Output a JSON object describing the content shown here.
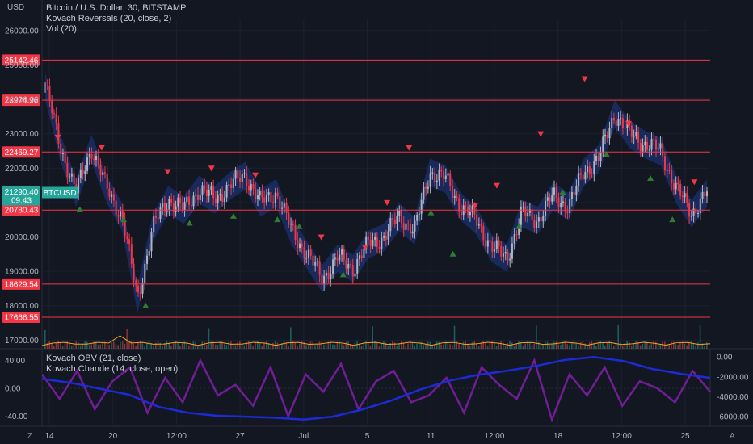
{
  "header": {
    "currency_label": "USD",
    "symbol_line": "Bitcoin / U.S. Dollar, 30, BITSTAMP",
    "indicator_1": "Kovach Reversals (20, close, 2)",
    "indicator_2": "Vol (20)"
  },
  "sub_pane": {
    "indicator_1": "Kovach OBV (21, close)",
    "indicator_2": "Kovach Chande (14, close, open)"
  },
  "price_badge": {
    "price": "21290.40",
    "countdown": "09:43",
    "symbol": "BTCUSD",
    "color": "#26a69a"
  },
  "colors": {
    "background": "#131722",
    "level_line": "#f23645",
    "candle_up": "#b2b5be",
    "reversal_up": "#2e7d32",
    "reversal_down": "#f23645",
    "band": "#1e3a8a",
    "chande": "#7b1fa2",
    "obv": "#1c2bd6",
    "volume": "#f7a21b"
  },
  "footer": {
    "left_icon": "Z",
    "right_icon": "A"
  },
  "chart_data": [
    {
      "type": "line",
      "title": "Bitcoin / U.S. Dollar, 30, BITSTAMP",
      "x_ticks": [
        "14",
        "20",
        "12:00",
        "27",
        "Jul",
        "5",
        "11",
        "12:00",
        "18",
        "12:00",
        "25"
      ],
      "y_ticks": [
        "17000.00",
        "18000.00",
        "19000.00",
        "20000.00",
        "21000.00",
        "22000.00",
        "23000.00",
        "24000.00",
        "25000.00",
        "26000.00"
      ],
      "ylim": [
        16750,
        26300
      ],
      "price_path": [
        [
          "14",
          24400
        ],
        [
          "",
          22600
        ],
        [
          "",
          21300
        ],
        [
          "",
          22600
        ],
        [
          "",
          21400
        ],
        [
          "",
          20600
        ],
        [
          "20",
          18200
        ],
        [
          "",
          20300
        ],
        [
          "",
          21100
        ],
        [
          "",
          20800
        ],
        [
          "",
          21400
        ],
        [
          "",
          21100
        ],
        [
          "12:00",
          21500
        ],
        [
          "",
          21800
        ],
        [
          "",
          21000
        ],
        [
          "27",
          21300
        ],
        [
          "",
          20200
        ],
        [
          "",
          19500
        ],
        [
          "Jul",
          18800
        ],
        [
          "",
          19400
        ],
        [
          "",
          19100
        ],
        [
          "",
          19800
        ],
        [
          "",
          20000
        ],
        [
          "5",
          20600
        ],
        [
          "",
          20200
        ],
        [
          "",
          21900
        ],
        [
          "",
          21700
        ],
        [
          "",
          20900
        ],
        [
          "",
          20500
        ],
        [
          "11",
          19700
        ],
        [
          "",
          19400
        ],
        [
          "",
          20700
        ],
        [
          "12:00",
          20500
        ],
        [
          "",
          21200
        ],
        [
          "",
          20900
        ],
        [
          "18",
          21900
        ],
        [
          "",
          22300
        ],
        [
          "",
          23600
        ],
        [
          "12:00",
          23000
        ],
        [
          "",
          22700
        ],
        [
          "",
          22500
        ],
        [
          "25",
          21400
        ],
        [
          "",
          20700
        ],
        [
          "",
          21290
        ]
      ],
      "levels": [
        "25142.46",
        "23974.96",
        "22469.27",
        "20780.43",
        "18629.54",
        "17666.55"
      ],
      "reversals": [
        {
          "x": "",
          "y": 22900,
          "dir": "down"
        },
        {
          "x": "",
          "y": 20800,
          "dir": "up"
        },
        {
          "x": "",
          "y": 22600,
          "dir": "down"
        },
        {
          "x": "",
          "y": 20500,
          "dir": "up"
        },
        {
          "x": "20",
          "y": 18000,
          "dir": "up"
        },
        {
          "x": "",
          "y": 21900,
          "dir": "down"
        },
        {
          "x": "",
          "y": 20400,
          "dir": "up"
        },
        {
          "x": "12:00",
          "y": 22000,
          "dir": "down"
        },
        {
          "x": "",
          "y": 20600,
          "dir": "up"
        },
        {
          "x": "27",
          "y": 21800,
          "dir": "down"
        },
        {
          "x": "",
          "y": 20500,
          "dir": "up"
        },
        {
          "x": "",
          "y": 20300,
          "dir": "up"
        },
        {
          "x": "",
          "y": 20000,
          "dir": "down"
        },
        {
          "x": "Jul",
          "y": 18900,
          "dir": "up"
        },
        {
          "x": "",
          "y": 19700,
          "dir": "down"
        },
        {
          "x": "5",
          "y": 21000,
          "dir": "down"
        },
        {
          "x": "",
          "y": 22600,
          "dir": "down"
        },
        {
          "x": "",
          "y": 20700,
          "dir": "up"
        },
        {
          "x": "11",
          "y": 19500,
          "dir": "up"
        },
        {
          "x": "",
          "y": 20900,
          "dir": "down"
        },
        {
          "x": "12:00",
          "y": 21500,
          "dir": "down"
        },
        {
          "x": "",
          "y": 20300,
          "dir": "up"
        },
        {
          "x": "18",
          "y": 23000,
          "dir": "down"
        },
        {
          "x": "",
          "y": 21300,
          "dir": "up"
        },
        {
          "x": "12:00",
          "y": 24600,
          "dir": "down"
        },
        {
          "x": "",
          "y": 22400,
          "dir": "up"
        },
        {
          "x": "",
          "y": 23300,
          "dir": "down"
        },
        {
          "x": "25",
          "y": 21700,
          "dir": "up"
        },
        {
          "x": "",
          "y": 20500,
          "dir": "up"
        },
        {
          "x": "",
          "y": 21600,
          "dir": "down"
        }
      ]
    },
    {
      "type": "line",
      "title": "Kovach OBV (21, close) / Kovach Chande (14, close, open)",
      "left_ticks": [
        "40.00",
        "0.00",
        "-40.00"
      ],
      "right_ticks": [
        "0.00",
        "-2000.00",
        "-4000.00",
        "-6000.00"
      ],
      "series": [
        {
          "name": "Kovach OBV (21, close)",
          "axis": "right",
          "values": [
            -2200,
            -2600,
            -3200,
            -3800,
            -5000,
            -5600,
            -5900,
            -6000,
            -6100,
            -6300,
            -6000,
            -5300,
            -4400,
            -3300,
            -2400,
            -1800,
            -1400,
            -900,
            -300,
            0,
            -400,
            -1200,
            -1700,
            -2100
          ]
        },
        {
          "name": "Kovach Chande (14, close, open)",
          "axis": "left",
          "values": [
            20,
            -15,
            25,
            -30,
            10,
            30,
            -35,
            15,
            -20,
            40,
            -10,
            5,
            -25,
            30,
            -40,
            20,
            -5,
            35,
            -30,
            10,
            25,
            -20,
            -10,
            15,
            -35,
            30,
            5,
            -15,
            40,
            -45,
            20,
            -10,
            30,
            -25,
            10,
            0,
            -20,
            25,
            -5
          ]
        }
      ]
    }
  ]
}
